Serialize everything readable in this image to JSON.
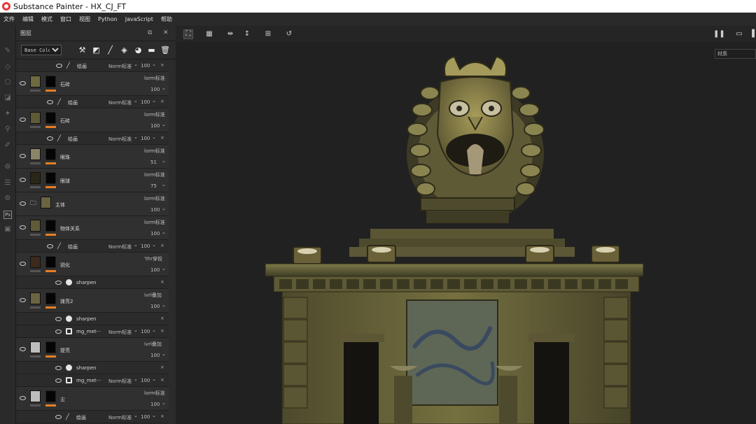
{
  "window": {
    "title": "Substance Painter - HX_CJ_FT"
  },
  "menu": [
    "文件",
    "编辑",
    "模式",
    "窗口",
    "视图",
    "Python",
    "JavaScript",
    "帮助"
  ],
  "layers_panel": {
    "title": "图层",
    "channel": "Base Color",
    "channel_options": [
      "Base Color"
    ]
  },
  "layers": [
    {
      "kind": "sub",
      "icon": "brush",
      "name": "绘画",
      "blend": "Norm标准",
      "opacity": "100",
      "close": "×"
    },
    {
      "kind": "layer",
      "name": "石砖",
      "blend": "lorm标准",
      "opacity": "100"
    },
    {
      "kind": "sub",
      "icon": "brush",
      "name": "绘画",
      "blend": "Norm标准",
      "opacity": "100",
      "close": "×"
    },
    {
      "kind": "layer",
      "name": "石砖",
      "blend": "lorm标准",
      "opacity": "100"
    },
    {
      "kind": "sub",
      "icon": "brush",
      "name": "绘画",
      "blend": "Norm标准",
      "opacity": "100",
      "close": "×"
    },
    {
      "kind": "layer",
      "name": "眼珠",
      "blend": "lorm标准",
      "opacity": "51"
    },
    {
      "kind": "layer",
      "name": "眼球",
      "blend": "lorm标准",
      "opacity": "75"
    },
    {
      "kind": "folder",
      "name": "主体",
      "blend": "lorm标准",
      "opacity": "100"
    },
    {
      "kind": "layer",
      "name": "物体关系",
      "blend": "lorm标准",
      "opacity": "100"
    },
    {
      "kind": "sub",
      "icon": "brush",
      "name": "绘画",
      "blend": "Norm标准",
      "opacity": "100",
      "close": "×"
    },
    {
      "kind": "layer",
      "name": "锐化",
      "blend": "'thr穿投",
      "opacity": "100"
    },
    {
      "kind": "sub",
      "icon": "fx",
      "name": "sharpen",
      "blend": "",
      "opacity": "",
      "close": "×"
    },
    {
      "kind": "layer",
      "name": "揉亮2",
      "blend": "ivrl叠加",
      "opacity": "100"
    },
    {
      "kind": "sub",
      "icon": "fx",
      "name": "sharpen",
      "blend": "",
      "opacity": "",
      "close": "×"
    },
    {
      "kind": "sub",
      "icon": "mask",
      "name": "mg_met···",
      "blend": "Norm标准",
      "opacity": "100",
      "close": "×"
    },
    {
      "kind": "layer",
      "name": "提亮",
      "blend": "ivrl叠加",
      "opacity": "100"
    },
    {
      "kind": "sub",
      "icon": "fx",
      "name": "sharpen",
      "blend": "",
      "opacity": "",
      "close": "×"
    },
    {
      "kind": "sub",
      "icon": "mask",
      "name": "mg_met···",
      "blend": "Norm标准",
      "opacity": "100",
      "close": "×"
    },
    {
      "kind": "layer",
      "name": "尘",
      "blend": "lorm标准",
      "opacity": "100"
    },
    {
      "kind": "sub",
      "icon": "brush",
      "name": "绘画",
      "blend": "Norm标准",
      "opacity": "100",
      "close": "×"
    }
  ],
  "viewport": {
    "material_dropdown": "材质"
  },
  "colors": {
    "accent_orange": "#e97d22",
    "panel_bg": "#2b2b2b",
    "viewport_bg": "#212121"
  }
}
